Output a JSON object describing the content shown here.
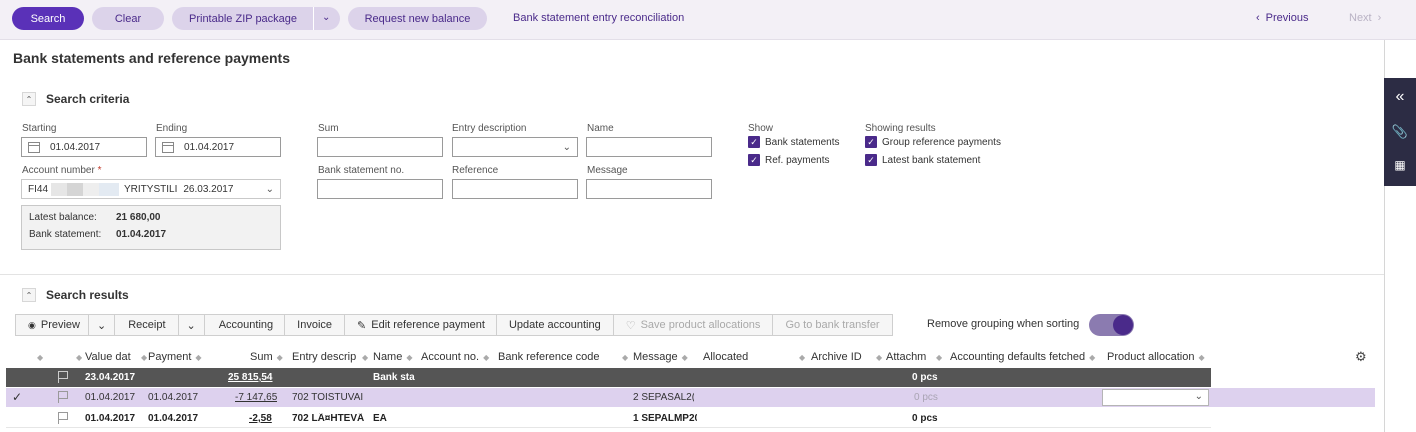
{
  "toolbar": {
    "search": "Search",
    "clear": "Clear",
    "printable_zip": "Printable ZIP package",
    "request_balance": "Request new balance",
    "reconciliation": "Bank statement entry reconciliation",
    "previous": "Previous",
    "next": "Next"
  },
  "page_title": "Bank statements and reference payments",
  "criteria": {
    "title": "Search criteria",
    "starting_label": "Starting",
    "starting_value": "01.04.2017",
    "ending_label": "Ending",
    "ending_value": "01.04.2017",
    "account_label": "Account number",
    "account_prefix": "FI44",
    "account_name": "YRITYSTILI",
    "account_date": "26.03.2017",
    "latest_balance_label": "Latest balance:",
    "latest_balance_value": "21 680,00",
    "bank_statement_label": "Bank statement:",
    "bank_statement_value": "01.04.2017",
    "sum_label": "Sum",
    "entry_desc_label": "Entry description",
    "name_label": "Name",
    "bank_stmt_no_label": "Bank statement no.",
    "reference_label": "Reference",
    "message_label": "Message",
    "show_label": "Show",
    "show_bank_statements": "Bank statements",
    "show_ref_payments": "Ref. payments",
    "showing_label": "Showing results",
    "group_ref_payments": "Group reference payments",
    "latest_bank_statement": "Latest bank statement"
  },
  "results": {
    "title": "Search results",
    "buttons": {
      "preview": "Preview",
      "receipt": "Receipt",
      "accounting": "Accounting",
      "invoice": "Invoice",
      "edit_ref": "Edit reference payment",
      "update_accounting": "Update accounting",
      "save_product": "Save product allocations",
      "go_bank_transfer": "Go to bank transfer"
    },
    "remove_grouping": "Remove grouping when sorting",
    "columns": {
      "value_date": "Value dat",
      "payment": "Payment",
      "sum": "Sum",
      "entry_desc": "Entry descrip",
      "name": "Name",
      "account_no": "Account no.",
      "bank_ref_code": "Bank reference code",
      "message": "Message",
      "allocated": "Allocated",
      "archive_id": "Archive ID",
      "attachments": "Attachm",
      "acc_defaults": "Accounting defaults fetched",
      "product_allocation": "Product allocation"
    },
    "group_row": {
      "value_date": "23.04.2017",
      "sum": "25 815,54",
      "name": "Bank sta",
      "attachments": "0 pcs"
    },
    "rows": [
      {
        "check": "✓",
        "value_date": "01.04.2017",
        "payment": "01.04.2017",
        "sum": "-7 147,65",
        "entry_desc": "702 TOISTUVAI",
        "name": "",
        "message": "2 SEPASAL2(",
        "attachments": "0 pcs"
      },
      {
        "check": "",
        "value_date": "01.04.2017",
        "payment": "01.04.2017",
        "sum": "-2,58",
        "entry_desc": "702 LÃ¤HTEVÃ¤",
        "name": "EA",
        "message": "1 SEPALMP20",
        "attachments": "0 pcs"
      }
    ]
  },
  "colors": {
    "primary": "#5a31b8",
    "pill": "#dcd3ea",
    "accent_text": "#4a2a8a",
    "rail": "#2c2c44",
    "group_row": "#555555",
    "selected_row": "#ddd1ee"
  }
}
